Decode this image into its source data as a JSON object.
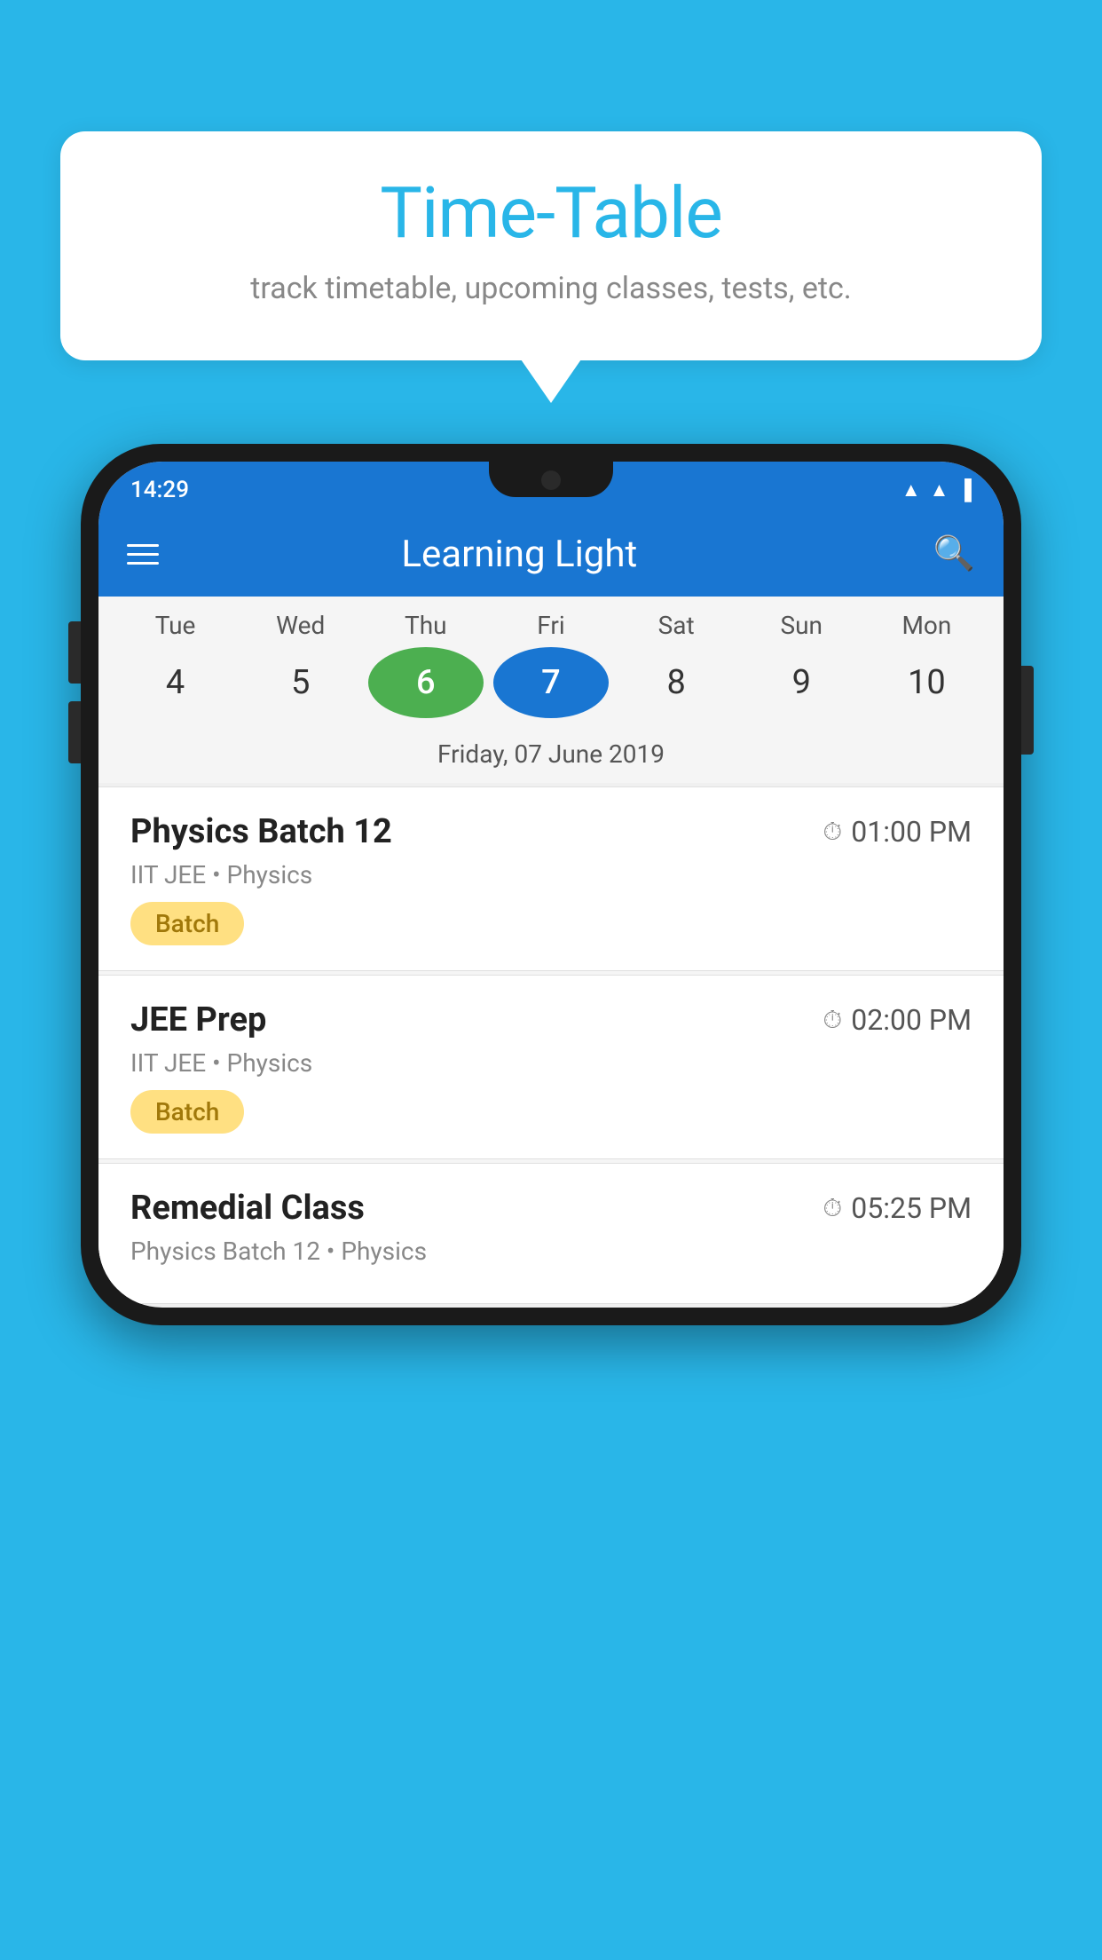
{
  "background_color": "#29b6e8",
  "tooltip": {
    "title": "Time-Table",
    "subtitle": "track timetable, upcoming classes, tests, etc."
  },
  "phone": {
    "status_bar": {
      "time": "14:29"
    },
    "app_bar": {
      "title": "Learning Light",
      "menu_label": "menu",
      "search_label": "search"
    },
    "calendar": {
      "days": [
        {
          "label": "Tue",
          "num": "4"
        },
        {
          "label": "Wed",
          "num": "5"
        },
        {
          "label": "Thu",
          "num": "6",
          "state": "today"
        },
        {
          "label": "Fri",
          "num": "7",
          "state": "selected"
        },
        {
          "label": "Sat",
          "num": "8"
        },
        {
          "label": "Sun",
          "num": "9"
        },
        {
          "label": "Mon",
          "num": "10"
        }
      ],
      "selected_date": "Friday, 07 June 2019"
    },
    "schedule": [
      {
        "title": "Physics Batch 12",
        "time": "01:00 PM",
        "subtitle": "IIT JEE • Physics",
        "badge": "Batch"
      },
      {
        "title": "JEE Prep",
        "time": "02:00 PM",
        "subtitle": "IIT JEE • Physics",
        "badge": "Batch"
      },
      {
        "title": "Remedial Class",
        "time": "05:25 PM",
        "subtitle": "Physics Batch 12 • Physics",
        "badge": ""
      }
    ]
  }
}
